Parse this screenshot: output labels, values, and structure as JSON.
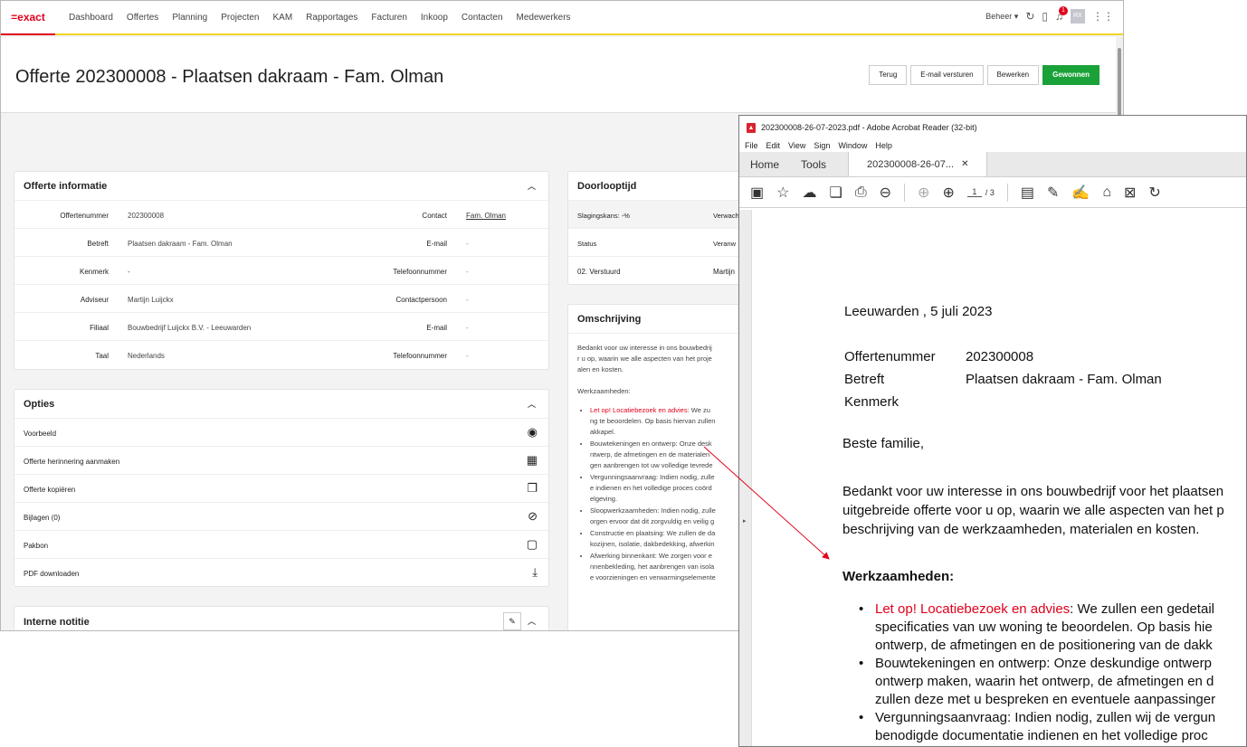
{
  "app": {
    "logo": "=exact",
    "nav": [
      "Dashboard",
      "Offertes",
      "Planning",
      "Projecten",
      "KAM",
      "Rapportages",
      "Facturen",
      "Inkoop",
      "Contacten",
      "Medewerkers"
    ],
    "beheer": "Beheer",
    "notification_count": "1",
    "avatar": "RX"
  },
  "page": {
    "title": "Offerte 202300008 - Plaatsen dakraam - Fam. Olman",
    "actions": {
      "back": "Terug",
      "email": "E-mail versturen",
      "edit": "Bewerken",
      "won": "Gewonnen"
    }
  },
  "info": {
    "title": "Offerte informatie",
    "rows": [
      {
        "l1": "Offertenummer",
        "v1": "202300008",
        "l2": "Contact",
        "v2": "Fam. Olman"
      },
      {
        "l1": "Betreft",
        "v1": "Plaatsen dakraam - Fam. Olman",
        "l2": "E-mail",
        "v2": "-"
      },
      {
        "l1": "Kenmerk",
        "v1": "-",
        "l2": "Telefoonnummer",
        "v2": "-"
      },
      {
        "l1": "Adviseur",
        "v1": "Martijn Luijckx",
        "l2": "Contactpersoon",
        "v2": "-"
      },
      {
        "l1": "Filiaal",
        "v1": "Bouwbedrijf Luijckx B.V. - Leeuwarden",
        "l2": "E-mail",
        "v2": "-"
      },
      {
        "l1": "Taal",
        "v1": "Nederlands",
        "l2": "Telefoonnummer",
        "v2": "-"
      }
    ]
  },
  "options": {
    "title": "Opties",
    "items": [
      "Voorbeeld",
      "Offerte herinnering aanmaken",
      "Offerte kopiëren",
      "Bijlagen (0)",
      "Pakbon",
      "PDF downloaden"
    ]
  },
  "notes": {
    "title": "Interne notitie"
  },
  "doorloop": {
    "title": "Doorlooptijd",
    "kans": "Slagingskans: -%",
    "verwacht": "Verwach",
    "status_label": "Status",
    "verantw": "Veranw",
    "status": "02. Verstuurd",
    "person": "Martijn"
  },
  "omschrijving": {
    "title": "Omschrijving",
    "intro1": "Bedankt voor uw interesse in ons bouwbedrij",
    "intro2": "r u op, waarin we alle aspecten van het proje",
    "intro3": "alen en kosten.",
    "work": "Werkzaamheden:",
    "b1_red": "Let op! Locatiebezoek en advies",
    "b1_a": ": We zu",
    "b1_b": "ng te beoordelen. Op basis hiervan zullen",
    "b1_c": "akkapel.",
    "b2_a": "Bouwtekeningen en ontwerp: Onze desk",
    "b2_b": "ntwerp, de afmetingen en de materialen",
    "b2_c": "gen aanbrengen tot uw volledige tevrede",
    "b3_a": "Vergunningsaanvraag: Indien nodig, zulle",
    "b3_b": "e indienen en het volledige proces coörd",
    "b3_c": "elgeving.",
    "b4_a": "Sloopwerkzaamheden: Indien nodig, zulle",
    "b4_b": "orgen ervoor dat dit zorgvuldig en veilig g",
    "b5_a": "Constructie en plaatsing: We zullen de da",
    "b5_b": "kozijnen, isolatie, dakbedekking, afwerkin",
    "b6_a": "Afwerking binnenkant: We zorgen voor e",
    "b6_b": "nnenbekleding, het aanbrengen van isola",
    "b6_c": "e voorzieningen en verwarmingselemente"
  },
  "acrobat": {
    "window_title": "202300008-26-07-2023.pdf - Adobe Acrobat Reader (32-bit)",
    "menu": [
      "File",
      "Edit",
      "View",
      "Sign",
      "Window",
      "Help"
    ],
    "tab_home": "Home",
    "tab_tools": "Tools",
    "tab_doc": "202300008-26-07...",
    "page_num": "1",
    "page_total": "/ 3",
    "pdf": {
      "date": "Leeuwarden , 5 juli 2023",
      "l_nr": "Offertenummer",
      "v_nr": "202300008",
      "l_betreft": "Betreft",
      "v_betreft": "Plaatsen dakraam - Fam. Olman",
      "l_kenmerk": "Kenmerk",
      "greeting": "Beste familie,",
      "p1": "Bedankt voor uw interesse in ons bouwbedrijf voor het plaatsen",
      "p2": "uitgebreide offerte voor u op, waarin we alle aspecten van het p",
      "p3": "beschrijving van de werkzaamheden, materialen en kosten.",
      "work": "Werkzaamheden:",
      "b1_red": "Let op! Locatiebezoek en advies",
      "b1_a": ": We zullen een gedetail",
      "b1_b": "specificaties van uw woning te beoordelen. Op basis hie",
      "b1_c": "ontwerp, de afmetingen en de positionering van de dakk",
      "b2_a": "Bouwtekeningen en ontwerp: Onze deskundige ontwerp",
      "b2_b": "ontwerp maken, waarin het ontwerp, de afmetingen en d",
      "b2_c": "zullen deze met u bespreken en eventuele aanpassinger",
      "b3_a": "Vergunningsaanvraag: Indien nodig, zullen wij de vergun",
      "b3_b": "benodigde documentatie indienen en het volledige proc"
    }
  }
}
